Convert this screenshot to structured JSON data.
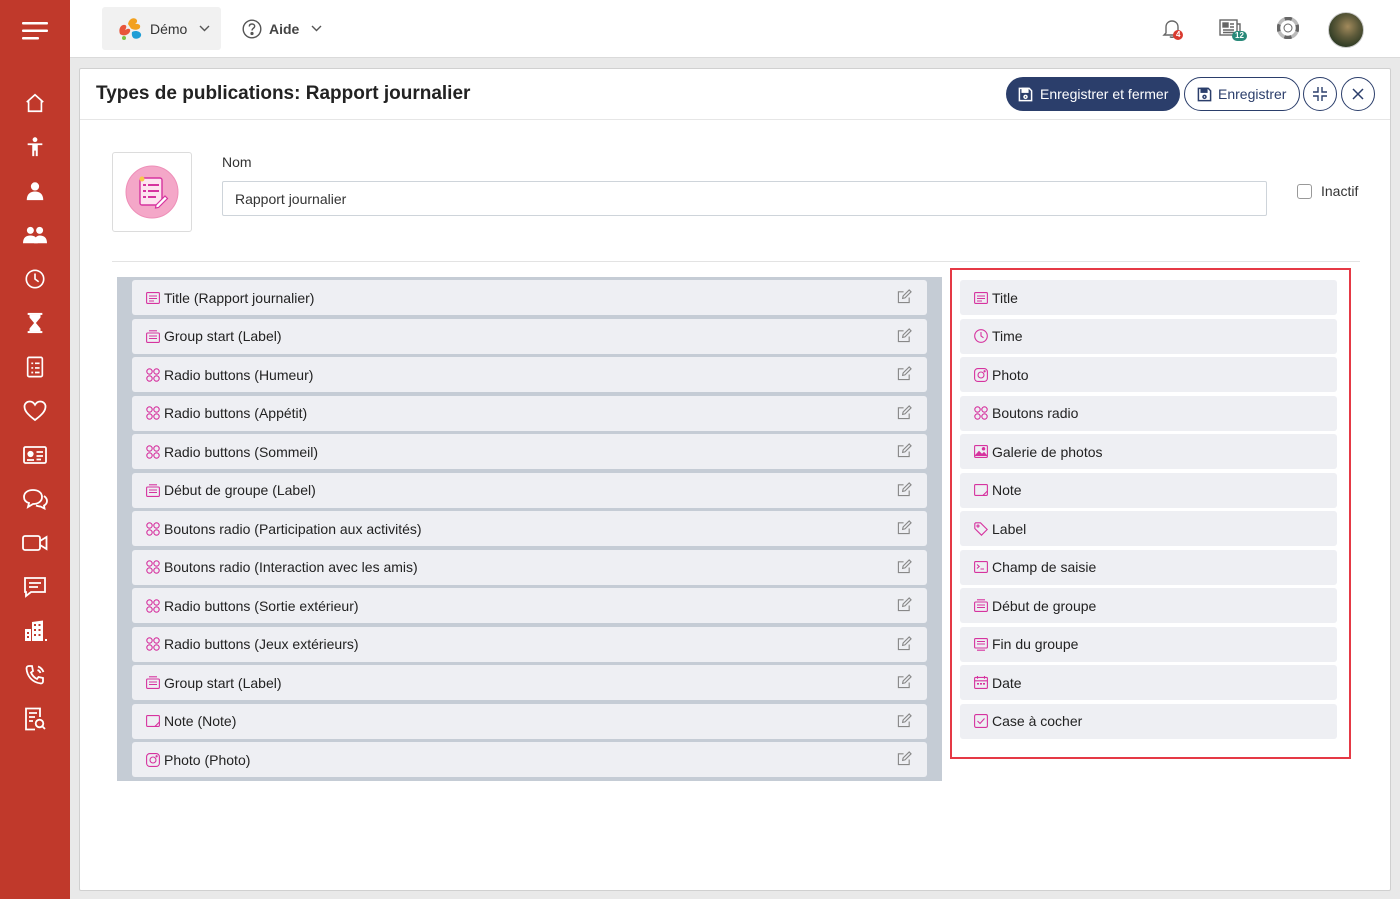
{
  "app": {
    "demo_label": "Démo",
    "aide_label": "Aide",
    "notifications_count": "4",
    "news_count": "12"
  },
  "sidebar": {
    "items": [
      "home-icon",
      "child-icon",
      "user-icon",
      "users-icon",
      "clock-icon",
      "hourglass-icon",
      "list-doc-icon",
      "heart-icon",
      "id-card-icon",
      "chat-icon",
      "video-icon",
      "message-icon",
      "building-icon",
      "phone-icon",
      "report-icon"
    ]
  },
  "page": {
    "title": "Types de publications: Rapport journalier",
    "save_close_label": "Enregistrer et fermer",
    "save_label": "Enregistrer",
    "nom_label": "Nom",
    "nom_value": "Rapport journalier",
    "inactif_label": "Inactif"
  },
  "fields": [
    {
      "type": "title",
      "label": "Title (Rapport journalier)"
    },
    {
      "type": "group",
      "label": "Group start (Label)"
    },
    {
      "type": "radio",
      "label": "Radio buttons (Humeur)"
    },
    {
      "type": "radio",
      "label": "Radio buttons (Appétit)"
    },
    {
      "type": "radio",
      "label": "Radio buttons (Sommeil)"
    },
    {
      "type": "group",
      "label": "Début de groupe (Label)"
    },
    {
      "type": "radio",
      "label": "Boutons radio (Participation aux activités)"
    },
    {
      "type": "radio",
      "label": "Boutons radio (Interaction avec les amis)"
    },
    {
      "type": "radio",
      "label": "Radio buttons (Sortie extérieur)"
    },
    {
      "type": "radio",
      "label": "Radio buttons (Jeux extérieurs)"
    },
    {
      "type": "group",
      "label": "Group start (Label)"
    },
    {
      "type": "note",
      "label": "Note (Note)"
    },
    {
      "type": "photo",
      "label": "Photo (Photo)"
    }
  ],
  "palette": [
    {
      "type": "title",
      "label": "Title"
    },
    {
      "type": "time",
      "label": "Time"
    },
    {
      "type": "photo",
      "label": "Photo"
    },
    {
      "type": "radio",
      "label": "Boutons radio"
    },
    {
      "type": "gallery",
      "label": "Galerie de photos"
    },
    {
      "type": "note",
      "label": "Note"
    },
    {
      "type": "label",
      "label": "Label"
    },
    {
      "type": "input",
      "label": "Champ de saisie"
    },
    {
      "type": "group",
      "label": "Début de groupe"
    },
    {
      "type": "groupend",
      "label": "Fin du groupe"
    },
    {
      "type": "date",
      "label": "Date"
    },
    {
      "type": "checkbox",
      "label": "Case à cocher"
    }
  ],
  "colors": {
    "sidebar": "#c0392b",
    "primary": "#2b3e6b",
    "icon_pink": "#d6339f",
    "highlight": "#e53945"
  }
}
